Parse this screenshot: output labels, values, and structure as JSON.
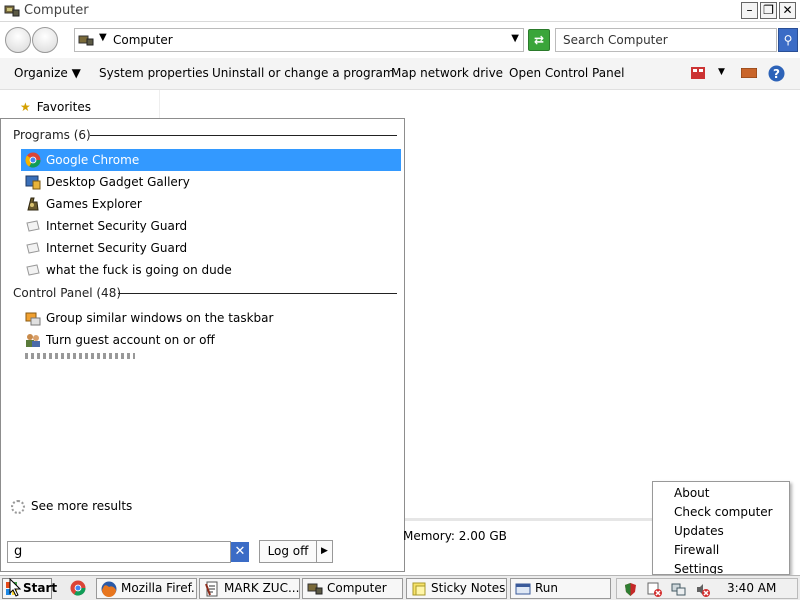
{
  "window": {
    "title": "Computer"
  },
  "address": {
    "crumb": "Computer",
    "search_placeholder": "Search Computer"
  },
  "toolbar": {
    "organize": "Organize",
    "system_properties": "System properties",
    "uninstall": "Uninstall or change a program",
    "map_drive": "Map network drive",
    "control_panel": "Open Control Panel"
  },
  "nav": {
    "favorites": "Favorites"
  },
  "start_search": {
    "programs_header": "Programs (6)",
    "programs": [
      {
        "label": "Google Chrome",
        "icon": "chrome-icon"
      },
      {
        "label": "Desktop Gadget Gallery",
        "icon": "gadget-icon"
      },
      {
        "label": "Games Explorer",
        "icon": "games-icon"
      },
      {
        "label": "Internet Security Guard",
        "icon": "shortcut-icon"
      },
      {
        "label": "Internet Security Guard",
        "icon": "shortcut-icon"
      },
      {
        "label": "what the fuck is going on dude",
        "icon": "shortcut-icon"
      }
    ],
    "control_panel_header": "Control Panel (48)",
    "control_panel": [
      {
        "label": "Group similar windows on the taskbar",
        "icon": "taskbar-settings-icon"
      },
      {
        "label": "Turn guest account on or off",
        "icon": "users-icon"
      }
    ],
    "see_more": "See more results",
    "query": "g",
    "log_off": "Log off"
  },
  "details": {
    "memory": "Memory:  2.00 GB"
  },
  "context_menu": {
    "items": [
      "About",
      "Check computer",
      "Updates",
      "Firewall",
      "Settings"
    ]
  },
  "taskbar": {
    "start": "Start",
    "tasks": [
      {
        "label": "Mozilla Firef...",
        "icon": "firefox-icon"
      },
      {
        "label": "MARK ZUC...",
        "icon": "document-icon"
      },
      {
        "label": "Computer",
        "icon": "computer-icon"
      },
      {
        "label": "Sticky Notes",
        "icon": "sticky-notes-icon"
      },
      {
        "label": "Run",
        "icon": "run-icon"
      }
    ],
    "clock": "3:40 AM"
  },
  "colors": {
    "selection": "#3399ff",
    "search_button": "#3b6cc6",
    "go_button": "#3aa53a"
  }
}
